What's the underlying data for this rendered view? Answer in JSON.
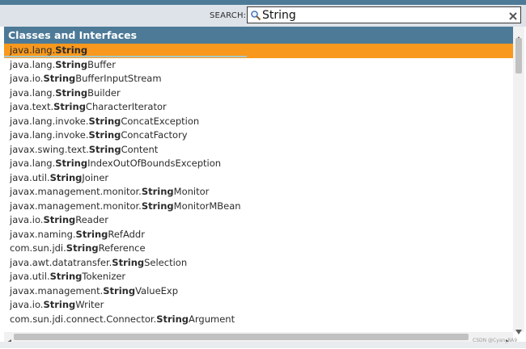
{
  "search": {
    "label": "SEARCH:",
    "value": "String"
  },
  "category": {
    "title": "Classes and Interfaces"
  },
  "results": [
    {
      "prefix": "java.lang.",
      "match": "String",
      "suffix": "",
      "selected": true
    },
    {
      "prefix": "java.lang.",
      "match": "String",
      "suffix": "Buffer"
    },
    {
      "prefix": "java.io.",
      "match": "String",
      "suffix": "BufferInputStream"
    },
    {
      "prefix": "java.lang.",
      "match": "String",
      "suffix": "Builder"
    },
    {
      "prefix": "java.text.",
      "match": "String",
      "suffix": "CharacterIterator"
    },
    {
      "prefix": "java.lang.invoke.",
      "match": "String",
      "suffix": "ConcatException"
    },
    {
      "prefix": "java.lang.invoke.",
      "match": "String",
      "suffix": "ConcatFactory"
    },
    {
      "prefix": "javax.swing.text.",
      "match": "String",
      "suffix": "Content"
    },
    {
      "prefix": "java.lang.",
      "match": "String",
      "suffix": "IndexOutOfBoundsException"
    },
    {
      "prefix": "java.util.",
      "match": "String",
      "suffix": "Joiner"
    },
    {
      "prefix": "javax.management.monitor.",
      "match": "String",
      "suffix": "Monitor"
    },
    {
      "prefix": "javax.management.monitor.",
      "match": "String",
      "suffix": "MonitorMBean"
    },
    {
      "prefix": "java.io.",
      "match": "String",
      "suffix": "Reader"
    },
    {
      "prefix": "javax.naming.",
      "match": "String",
      "suffix": "RefAddr"
    },
    {
      "prefix": "com.sun.jdi.",
      "match": "String",
      "suffix": "Reference"
    },
    {
      "prefix": "java.awt.datatransfer.",
      "match": "String",
      "suffix": "Selection"
    },
    {
      "prefix": "java.util.",
      "match": "String",
      "suffix": "Tokenizer"
    },
    {
      "prefix": "javax.management.",
      "match": "String",
      "suffix": "ValueExp"
    },
    {
      "prefix": "java.io.",
      "match": "String",
      "suffix": "Writer"
    },
    {
      "prefix": "com.sun.jdi.connect.Connector.",
      "match": "String",
      "suffix": "Argument"
    }
  ],
  "watermark": "CSDN @Cyan_RA9",
  "colors": {
    "header_bg": "#4d7a97",
    "search_bar_bg": "#dee3e9",
    "selected_bg": "#f8981d"
  },
  "icons": {
    "search": "magnifier-icon",
    "clear": "close-icon"
  }
}
